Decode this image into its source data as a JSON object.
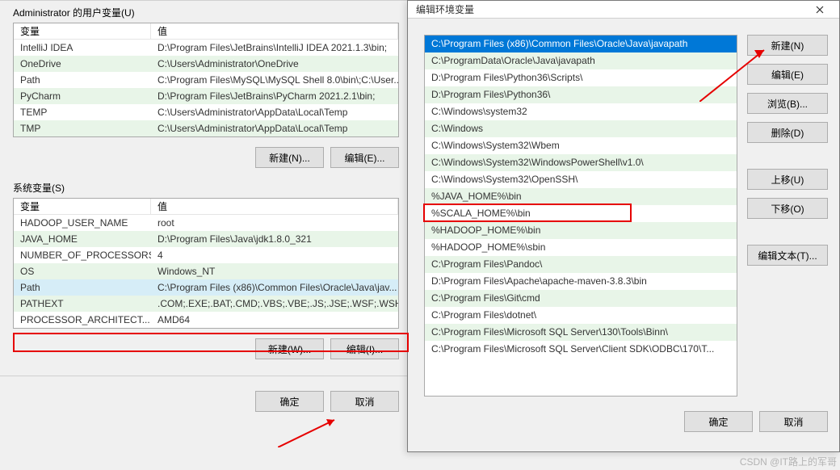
{
  "back": {
    "user_section_label": "Administrator 的用户变量(U)",
    "sys_section_label": "系统变量(S)",
    "headers": {
      "var": "变量",
      "val": "值"
    },
    "user_vars": [
      {
        "name": "IntelliJ IDEA",
        "value": "D:\\Program Files\\JetBrains\\IntelliJ IDEA 2021.1.3\\bin;"
      },
      {
        "name": "OneDrive",
        "value": "C:\\Users\\Administrator\\OneDrive"
      },
      {
        "name": "Path",
        "value": "C:\\Program Files\\MySQL\\MySQL Shell 8.0\\bin\\;C:\\User..."
      },
      {
        "name": "PyCharm",
        "value": "D:\\Program Files\\JetBrains\\PyCharm 2021.2.1\\bin;"
      },
      {
        "name": "TEMP",
        "value": "C:\\Users\\Administrator\\AppData\\Local\\Temp"
      },
      {
        "name": "TMP",
        "value": "C:\\Users\\Administrator\\AppData\\Local\\Temp"
      }
    ],
    "sys_vars": [
      {
        "name": "HADOOP_USER_NAME",
        "value": "root"
      },
      {
        "name": "JAVA_HOME",
        "value": "D:\\Program Files\\Java\\jdk1.8.0_321"
      },
      {
        "name": "NUMBER_OF_PROCESSORS",
        "value": "4"
      },
      {
        "name": "OS",
        "value": "Windows_NT"
      },
      {
        "name": "Path",
        "value": "C:\\Program Files (x86)\\Common Files\\Oracle\\Java\\jav..."
      },
      {
        "name": "PATHEXT",
        "value": ".COM;.EXE;.BAT;.CMD;.VBS;.VBE;.JS;.JSE;.WSF;.WSH;.M..."
      },
      {
        "name": "PROCESSOR_ARCHITECT...",
        "value": "AMD64"
      }
    ],
    "buttons": {
      "new_u": "新建(N)...",
      "edit_u": "编辑(E)...",
      "new_s": "新建(W)...",
      "edit_s": "编辑(I)...",
      "ok": "确定",
      "cancel": "取消"
    }
  },
  "front": {
    "title": "编辑环境变量",
    "paths": [
      "C:\\Program Files (x86)\\Common Files\\Oracle\\Java\\javapath",
      "C:\\ProgramData\\Oracle\\Java\\javapath",
      "D:\\Program Files\\Python36\\Scripts\\",
      "D:\\Program Files\\Python36\\",
      "C:\\Windows\\system32",
      "C:\\Windows",
      "C:\\Windows\\System32\\Wbem",
      "C:\\Windows\\System32\\WindowsPowerShell\\v1.0\\",
      "C:\\Windows\\System32\\OpenSSH\\",
      "%JAVA_HOME%\\bin",
      "%SCALA_HOME%\\bin",
      "%HADOOP_HOME%\\bin",
      "%HADOOP_HOME%\\sbin",
      "C:\\Program Files\\Pandoc\\",
      "D:\\Program Files\\Apache\\apache-maven-3.8.3\\bin",
      "C:\\Program Files\\Git\\cmd",
      "C:\\Program Files\\dotnet\\",
      "C:\\Program Files\\Microsoft SQL Server\\130\\Tools\\Binn\\",
      "C:\\Program Files\\Microsoft SQL Server\\Client SDK\\ODBC\\170\\T..."
    ],
    "buttons": {
      "new": "新建(N)",
      "edit": "编辑(E)",
      "browse": "浏览(B)...",
      "delete": "删除(D)",
      "up": "上移(U)",
      "down": "下移(O)",
      "edit_text": "编辑文本(T)...",
      "ok": "确定",
      "cancel": "取消"
    }
  },
  "watermark": "CSDN @IT路上的军哥"
}
